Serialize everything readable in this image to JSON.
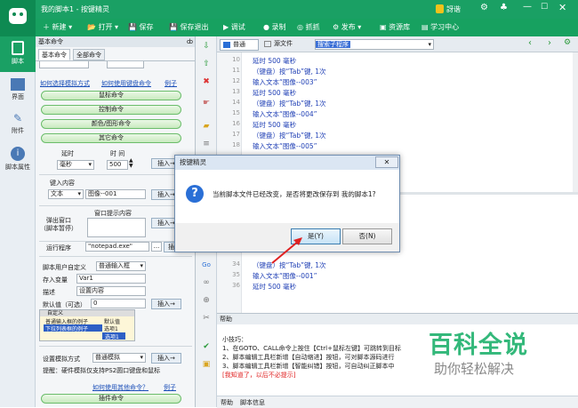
{
  "window": {
    "title": "我的脚本1 - 按键精灵",
    "user": "訝谐"
  },
  "toolbar": {
    "items": [
      "新建",
      "打开",
      "保存",
      "保存退出",
      "调试",
      "录制",
      "抓抓",
      "发布",
      "资源库",
      "学习中心"
    ]
  },
  "sidebar": {
    "items": [
      "脚本",
      "界面",
      "附件",
      "脚本属性"
    ]
  },
  "left_panel": {
    "section_title": "基本命令",
    "tabs": [
      "基本命令",
      "全部命令"
    ],
    "links": [
      "如何选择模拟方式",
      "如何使用键盘命令",
      "例子"
    ],
    "groups": [
      "鼠标命令",
      "控制命令",
      "颜色/图形命令",
      "其它命令"
    ],
    "delay": {
      "label1": "延时",
      "label2": "时 间",
      "unit": "毫秒",
      "value": "500",
      "insert": "插入→"
    },
    "input": {
      "label": "键入内容",
      "type": "文本",
      "value": "图像--001",
      "insert": "插入→"
    },
    "popup": {
      "label1": "弹出窗口",
      "label2": "（脚本暂停）",
      "label3": "窗口提示内容",
      "insert": "插入→"
    },
    "run": {
      "label": "运行程序",
      "value": "\"notepad.exe\"",
      "browse": "...",
      "insert": "插入→"
    },
    "custom": {
      "label": "脚本用户自定义",
      "mode": "普通输入框",
      "var_label": "存入变量",
      "var_value": "Var1",
      "desc_label": "描述",
      "desc_value": "设置内容",
      "default_label": "默认值（可选）",
      "default_value": "0",
      "insert": "插入→"
    },
    "preview": {
      "title": "自定义",
      "r1a": "普通输入框的例子",
      "r1b": "默认值",
      "r2a": "下拉列表框的例子",
      "r2b": "选项1",
      "r3": "选项1"
    },
    "sim": {
      "label": "设置模拟方式",
      "mode": "普通模拟",
      "insert": "插入→"
    },
    "tip": "提醒：硬件模拟仅支持PS2圆口键盘和鼠标",
    "bottom_links": [
      "如何使用其他命令？",
      "例子"
    ],
    "plugin": "插件命令"
  },
  "editor": {
    "tabs": [
      "普通",
      "源文件"
    ],
    "search_placeholder": "搜索子程序",
    "lines_top": [
      {
        "n": "10",
        "text": "延时 500 毫秒"
      },
      {
        "n": "11",
        "text": "（键盘）按“Tab”键, 1次"
      },
      {
        "n": "12",
        "text": "输入文本“图像--003”"
      },
      {
        "n": "13",
        "text": "延时 500 毫秒"
      },
      {
        "n": "14",
        "text": "（键盘）按“Tab”键, 1次"
      },
      {
        "n": "15",
        "text": "输入文本“图像--004”"
      },
      {
        "n": "16",
        "text": "延时 500 毫秒"
      },
      {
        "n": "17",
        "text": "（键盘）按“Tab”键, 1次"
      },
      {
        "n": "18",
        "text": "输入文本“图像--005”"
      }
    ],
    "lines_bottom": [
      {
        "n": "34",
        "text": "（键盘）按“Tab”键, 1次"
      },
      {
        "n": "35",
        "text": "输入文本“图像--001”"
      },
      {
        "n": "36",
        "text": "延时 500 毫秒"
      }
    ]
  },
  "help": {
    "title": "帮助",
    "lines": [
      "小技巧：",
      "1、在GOTO、CALL命令上按住【Ctrl+鼠标左键】可跳转到目标",
      "2、脚本编辑工具栏新增【自动缩进】按钮，可对脚本源码进行",
      "3、脚本编辑工具栏新增【智能纠错】按钮，可自动纠正脚本中",
      "[我知道了，以后不必提示]"
    ],
    "tabs": [
      "帮助",
      "脚本信息"
    ]
  },
  "dialog": {
    "title": "按键精灵",
    "message": "当前脚本文件已经改变，是否将更改保存到 我的脚本1?",
    "yes": "是(Y)",
    "no": "否(N)"
  },
  "watermark": {
    "main": "百科全说",
    "sub": "助你轻松解决"
  },
  "colors": {
    "brand_green": "#1aa064",
    "code_blue": "#1f3fb5",
    "link_blue": "#1b4fb8",
    "accent_red": "#e02020"
  }
}
